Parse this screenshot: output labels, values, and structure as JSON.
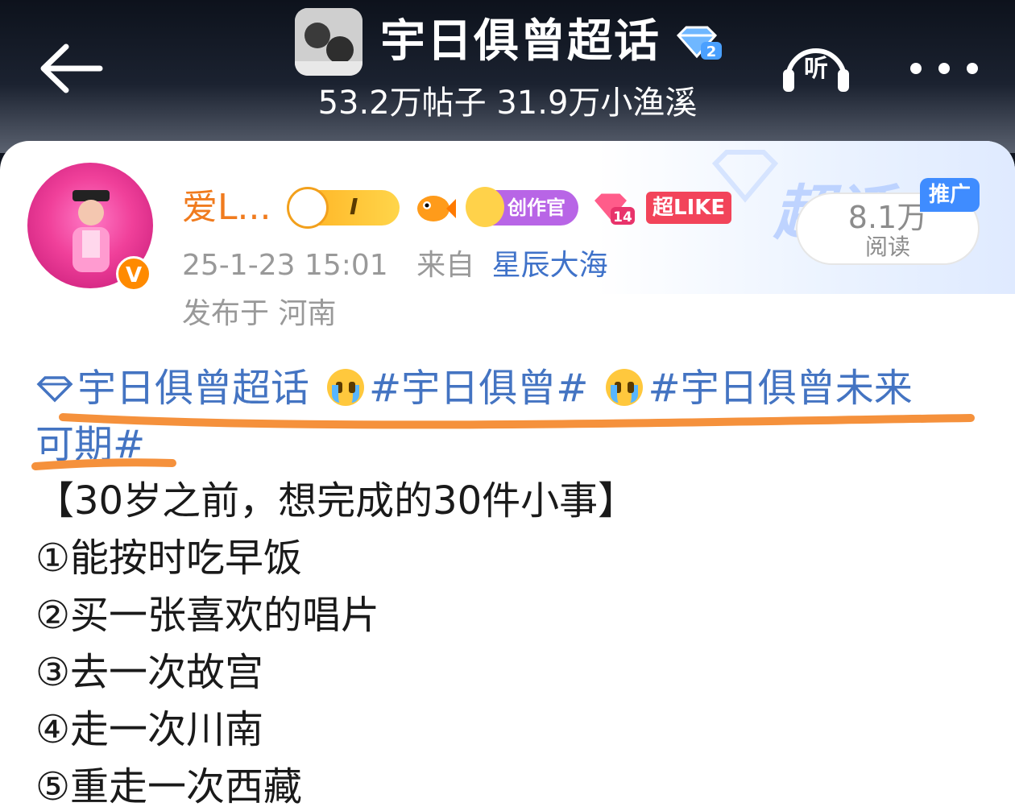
{
  "header": {
    "topic_title": "宇日俱曾超话",
    "topic_level": "2",
    "stats": "53.2万帖子 31.9万小渔溪",
    "listen_label": "听"
  },
  "post": {
    "user_name": "爱L...",
    "badges": {
      "rank_level": "I",
      "creator_label": "创作官",
      "gem_level": "14",
      "like_label": "超LIKE"
    },
    "timestamp": "25-1-23 15:01",
    "from_prefix": "来自",
    "source": "星辰大海",
    "location": "发布于 河南",
    "promo_label": "推广",
    "deco_label": "超话",
    "read_count": "8.1万",
    "read_label": "阅读",
    "tags": {
      "supertopic": "宇日俱曾超话",
      "tag1": "#宇日俱曾#",
      "tag2_part1": "#宇日俱曾未来",
      "tag2_part2": "可期#"
    },
    "content_lines": [
      "【30岁之前，想完成的30件小事】",
      "①能按时吃早饭",
      "②买一张喜欢的唱片",
      "③去一次故宫",
      "④走一次川南",
      "⑤重走一次西藏"
    ]
  },
  "colors": {
    "link_blue": "#4474c2",
    "username_orange": "#f07b1e",
    "underline_orange": "#f5913c"
  }
}
